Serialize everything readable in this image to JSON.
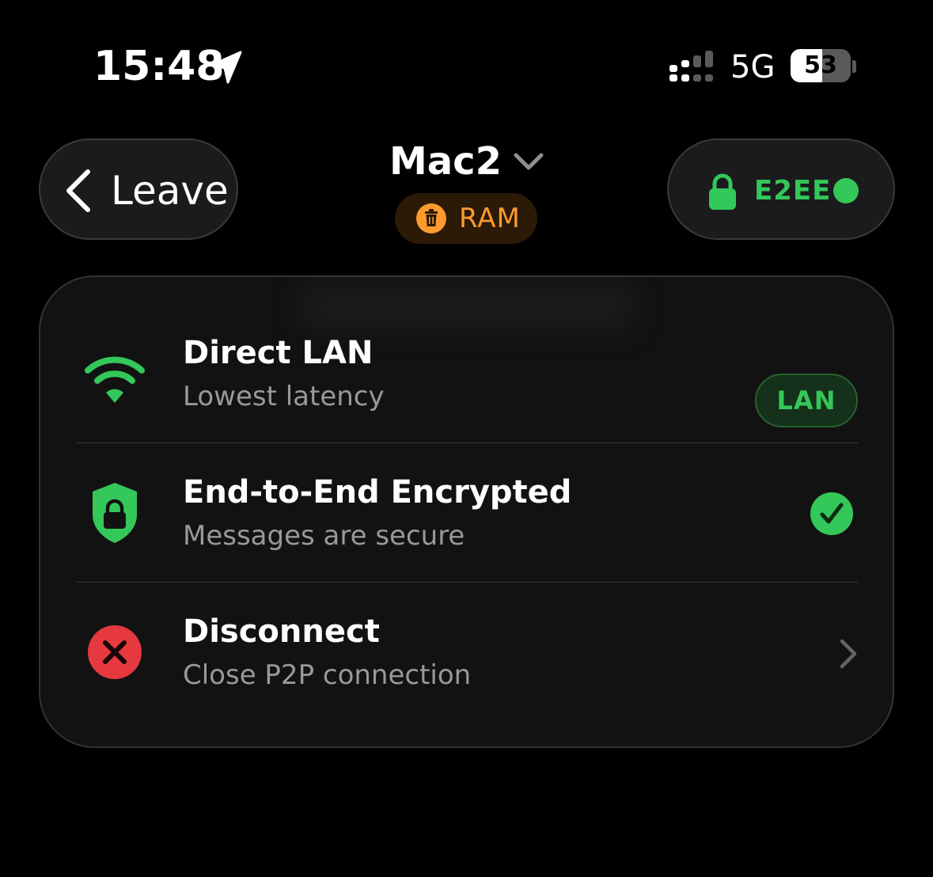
{
  "status_bar": {
    "time": "15:48",
    "network": "5G",
    "battery_level": "53",
    "battery_percent": 53,
    "icons": [
      "location-arrow-icon",
      "cellular-signal-icon",
      "battery-icon"
    ]
  },
  "header": {
    "leave_label": "Leave",
    "device_title": "Mac2",
    "storage_badge": "RAM",
    "encryption_label": "E2EE",
    "icons": [
      "back-chevron-icon",
      "chevron-down-icon",
      "trash-icon",
      "lock-icon",
      "status-dot-icon"
    ]
  },
  "menu": {
    "items": [
      {
        "title": "Direct LAN",
        "subtitle": "Lowest latency",
        "badge": "LAN",
        "icon": "wifi-icon"
      },
      {
        "title": "End-to-End Encrypted",
        "subtitle": "Messages are secure",
        "icon": "shield-lock-icon",
        "trailing_icon": "checkmark-circle-icon"
      },
      {
        "title": "Disconnect",
        "subtitle": "Close P2P connection",
        "icon": "close-circle-icon",
        "trailing_icon": "chevron-right-icon"
      }
    ]
  },
  "colors": {
    "background": "#000000",
    "accent_green": "#34c759",
    "accent_orange": "#ff9a2e",
    "danger_red": "#e5383f",
    "text_secondary": "#98989d"
  }
}
